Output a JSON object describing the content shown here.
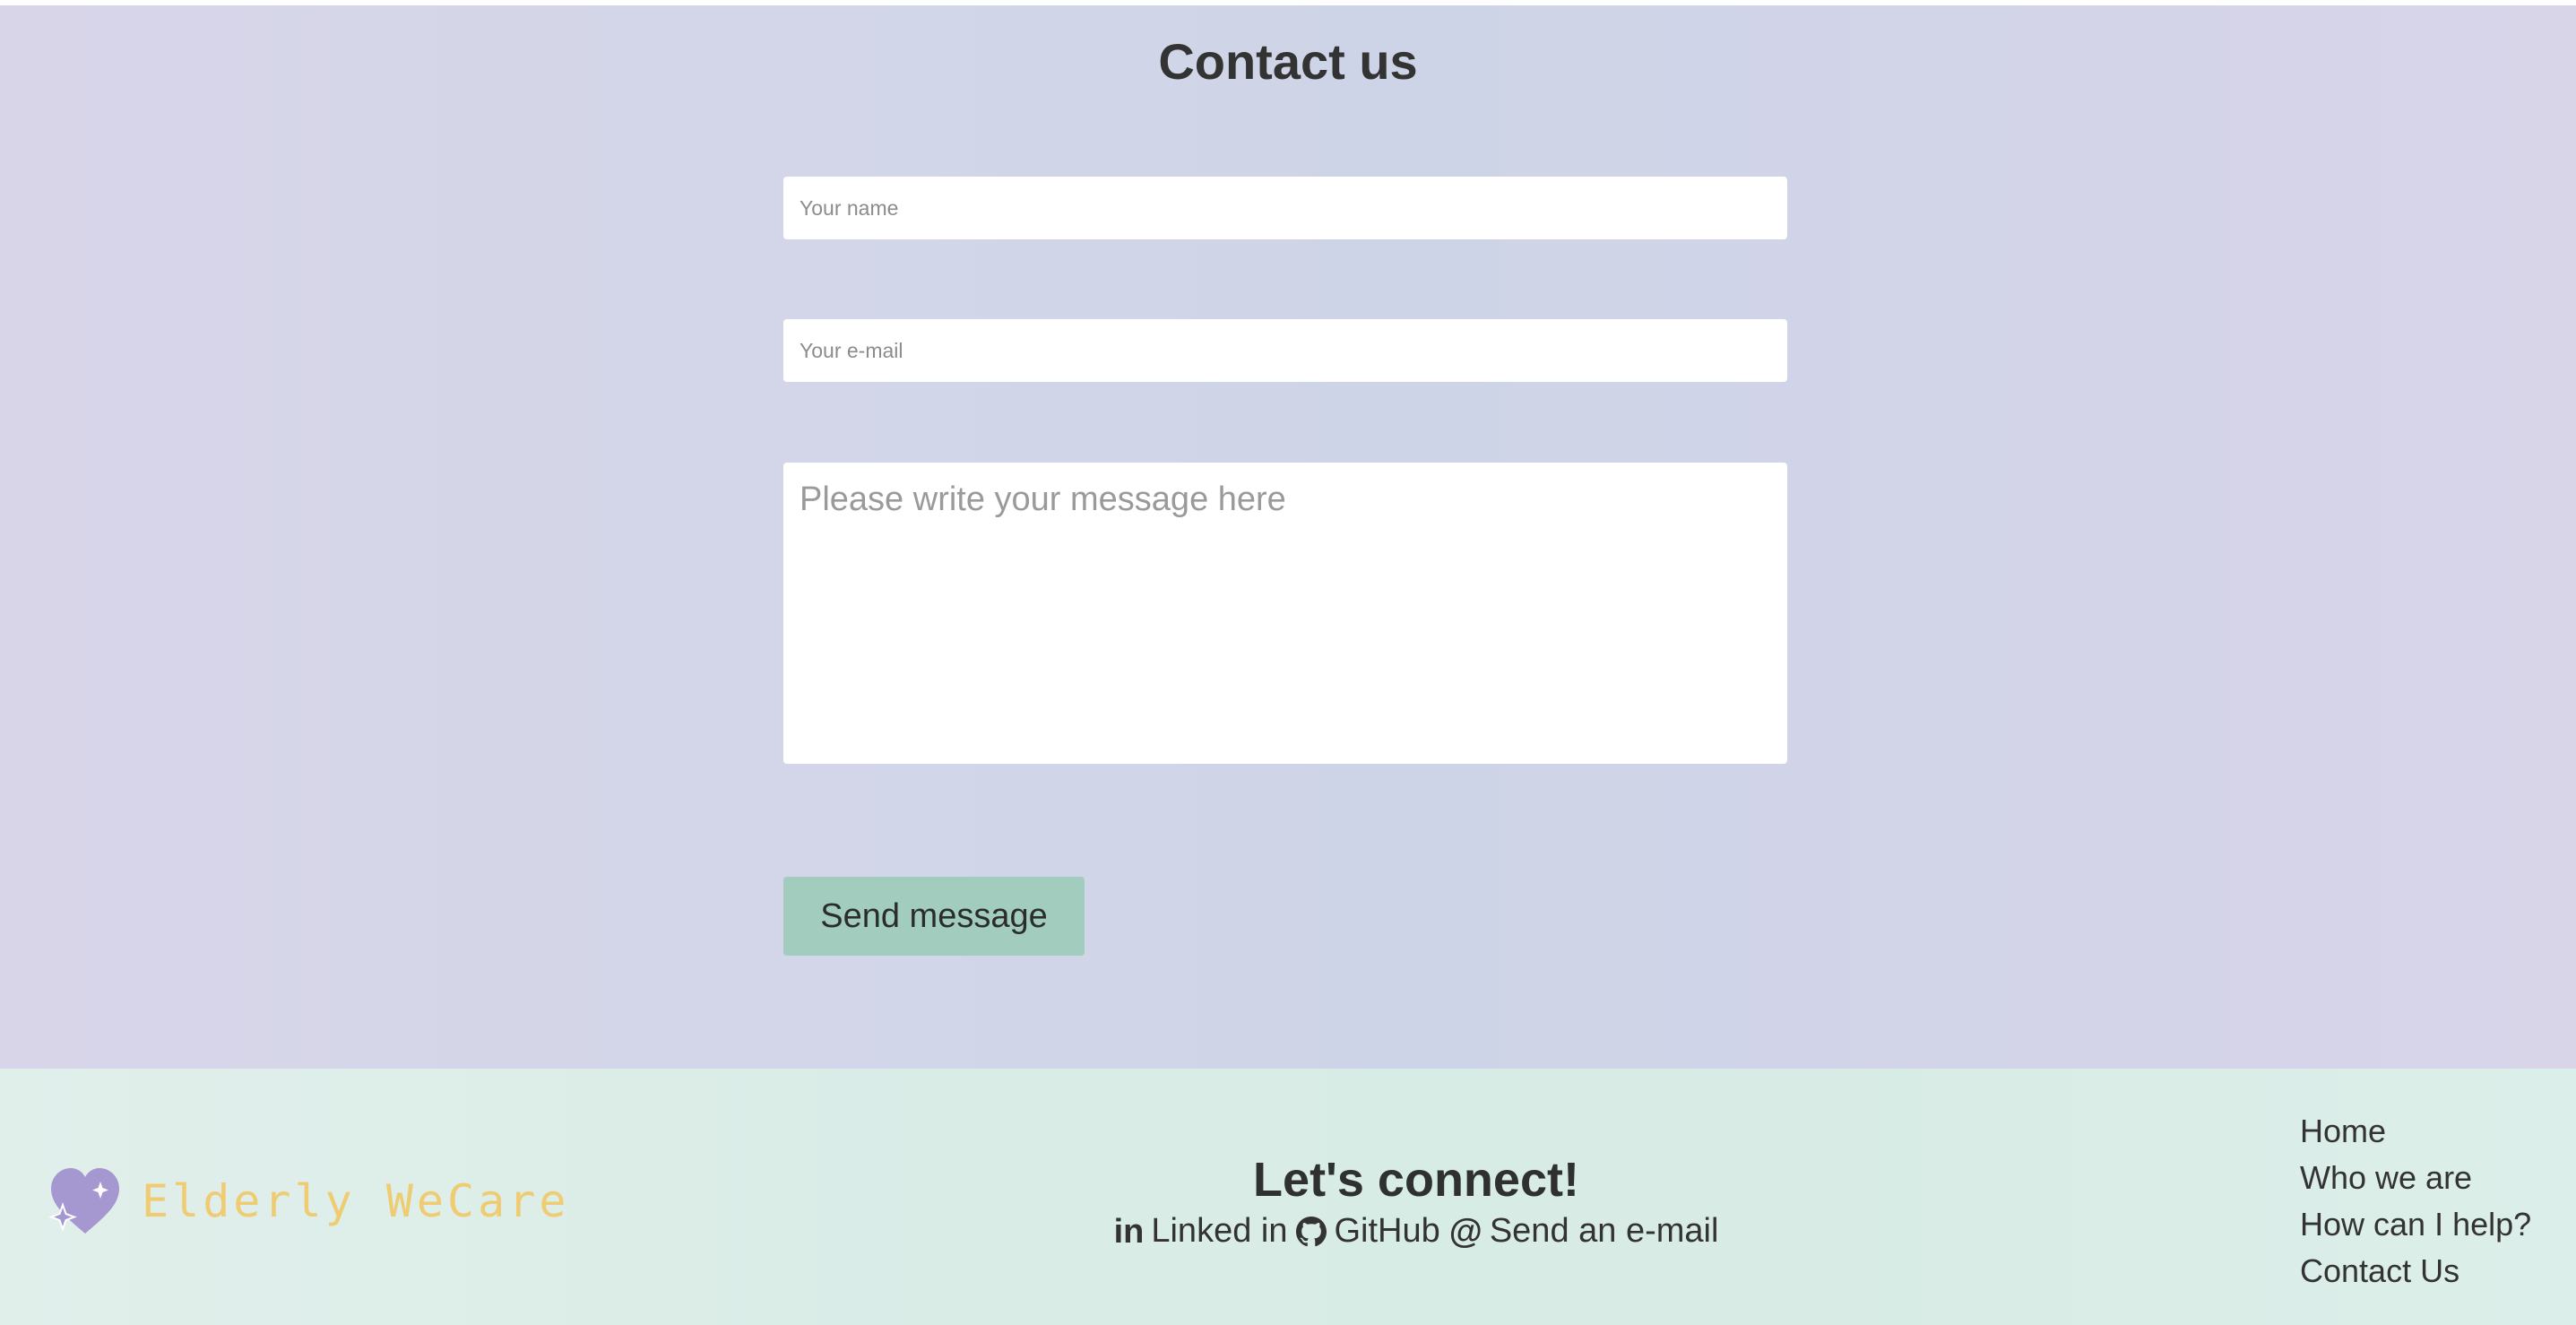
{
  "contact": {
    "title": "Contact us",
    "name_placeholder": "Your name",
    "email_placeholder": "Your e-mail",
    "message_placeholder": "Please write your message here",
    "send_label": "Send message"
  },
  "footer": {
    "brand": {
      "name": "Elderly WeCare",
      "icon": "heart-sparkles-icon"
    },
    "connect_title": "Let's connect!",
    "links": [
      {
        "icon": "linkedin-icon",
        "label": "Linked in"
      },
      {
        "icon": "github-icon",
        "label": "GitHub"
      },
      {
        "icon": "at-icon",
        "label": "Send an e-mail"
      }
    ],
    "nav": [
      "Home",
      "Who we are",
      "How can I help?",
      "Contact Us"
    ]
  },
  "colors": {
    "page_background": "#d2d6e8",
    "footer_background": "#d9ece6",
    "button_background": "#a2cdbe",
    "brand_text": "#efcb72",
    "logo": "#a597cf"
  }
}
